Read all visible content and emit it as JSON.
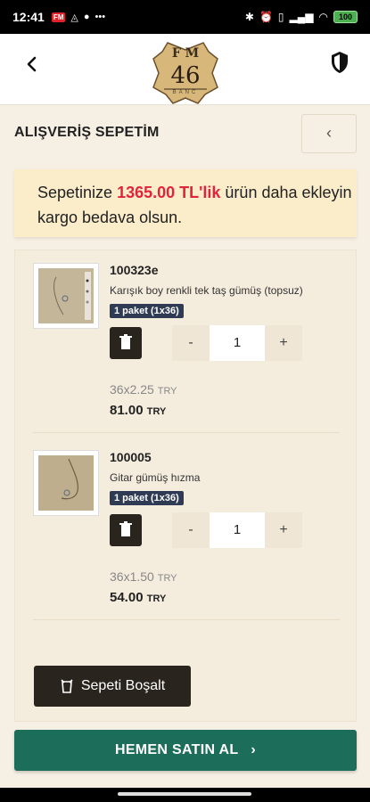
{
  "status_bar": {
    "time": "12:41",
    "notif_badge": "FM",
    "dots": "•••",
    "battery": "100"
  },
  "header": {
    "back_icon": "chevron-left-icon",
    "logo_letters": "F M",
    "logo_number": "46",
    "logo_sub": "BANC",
    "security_icon": "shield-icon"
  },
  "page": {
    "title": "ALIŞVERİŞ SEPETİM",
    "collapse_label": "‹"
  },
  "notice": {
    "prefix": "Sepetinize ",
    "amount": "1365.00 TL'lik",
    "suffix": " ürün daha ekleyin kargo bedava olsun."
  },
  "items": [
    {
      "code": "100323e",
      "name": "Karışık boy renkli tek taş gümüş (topsuz)",
      "package": "1 paket (1x36)",
      "quantity": "1",
      "minus": "-",
      "plus": "+",
      "unit_price": "36x2.25",
      "unit_currency": "TRY",
      "total": "81.00",
      "total_currency": "TRY"
    },
    {
      "code": "100005",
      "name": "Gitar gümüş hızma",
      "package": "1 paket (1x36)",
      "quantity": "1",
      "minus": "-",
      "plus": "+",
      "unit_price": "36x1.50",
      "unit_currency": "TRY",
      "total": "54.00",
      "total_currency": "TRY"
    }
  ],
  "actions": {
    "empty_cart": "Sepeti Boşalt",
    "buy_now": "HEMEN SATIN AL",
    "buy_arrow": "›"
  }
}
